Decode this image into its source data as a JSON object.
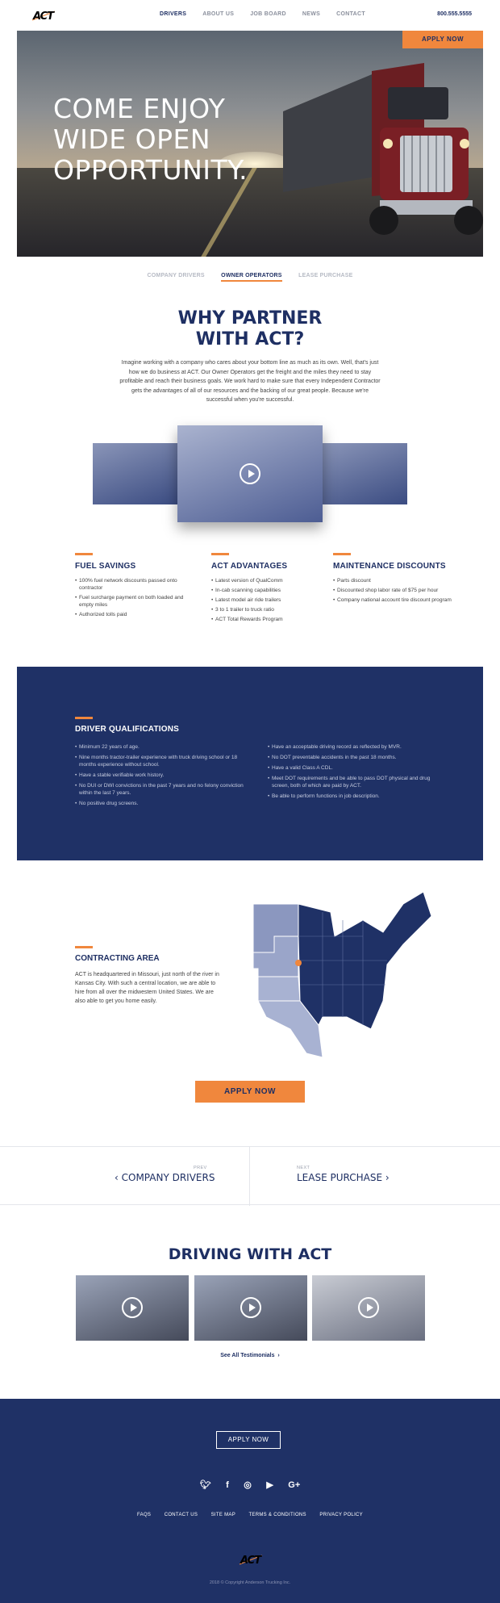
{
  "header": {
    "logo": "ACT",
    "nav": [
      "DRIVERS",
      "ABOUT US",
      "JOB BOARD",
      "NEWS",
      "CONTACT"
    ],
    "phone": "800.555.5555"
  },
  "hero": {
    "line1": "COME ENJOY",
    "line2": "WIDE OPEN",
    "line3": "OPPORTUNITY.",
    "apply_label": "APPLY NOW"
  },
  "tabs": [
    "COMPANY DRIVERS",
    "OWNER OPERATORS",
    "LEASE PURCHASE"
  ],
  "why": {
    "title_line1": "WHY PARTNER",
    "title_line2": "WITH ACT?",
    "text": "Imagine working with a company who cares about your bottom line as much as its own. Well, that's just how we do business at ACT. Our Owner Operators get the freight and the miles they need to stay profitable and reach their business goals. We work hard to make sure that every Independent Contractor gets the advantages of all of our resources and the backing of our great people. Because we're successful when you're successful."
  },
  "features": [
    {
      "title": "FUEL SAVINGS",
      "items": [
        "100% fuel network discounts passed onto contractor",
        "Fuel surcharge payment on both loaded and empty miles",
        "Authorized tolls paid"
      ]
    },
    {
      "title": "ACT ADVANTAGES",
      "items": [
        "Latest version of QualComm",
        "In-cab scanning capabilities",
        "Latest model air ride trailers",
        "3 to 1 trailer to truck ratio",
        "ACT Total Rewards Program"
      ]
    },
    {
      "title": "MAINTENANCE DISCOUNTS",
      "items": [
        "Parts discount",
        "Discounted shop labor rate of $75 per hour",
        "Company national account tire discount program"
      ]
    }
  ],
  "qualifications": {
    "title": "DRIVER QUALIFICATIONS",
    "left": [
      "Minimum 22 years of age.",
      "Nine months tractor-trailer experience with truck driving school or 18 months experience without school.",
      "Have a stable verifiable work history.",
      "No DUI or DWI convictions in the past 7 years and no felony conviction within the last 7 years.",
      "No positive drug screens."
    ],
    "right": [
      "Have an acceptable driving record as reflected by MVR.",
      "No DOT preventable accidents in the past 18 months.",
      "Have a valid Class A CDL.",
      "Meet DOT requirements and be able to pass DOT physical and drug screen, both of which are paid by ACT.",
      "Be able to perform functions in job description."
    ]
  },
  "contracting": {
    "title": "CONTRACTING AREA",
    "text": "ACT is headquartered in Missouri, just north of the river in Kansas City. With such a central location, we are able to hire from all over the midwestern United States. We are also able to get you home easily."
  },
  "apply_mid": "APPLY NOW",
  "prevnext": {
    "prev_small": "PREV",
    "prev_label": "COMPANY DRIVERS",
    "next_small": "NEXT",
    "next_label": "LEASE PURCHASE"
  },
  "testimonials": {
    "title": "DRIVING WITH ACT",
    "see_all": "See All Testimonials"
  },
  "footer": {
    "apply_label": "APPLY NOW",
    "links": [
      "FAQS",
      "CONTACT US",
      "SITE MAP",
      "TERMS & CONDITIONS",
      "PRIVACY POLICY"
    ],
    "logo": "ACT",
    "copyright": "2018 © Copyright Anderson Trucking Inc."
  },
  "colors": {
    "navy": "#1f3166",
    "orange": "#f0873d"
  }
}
